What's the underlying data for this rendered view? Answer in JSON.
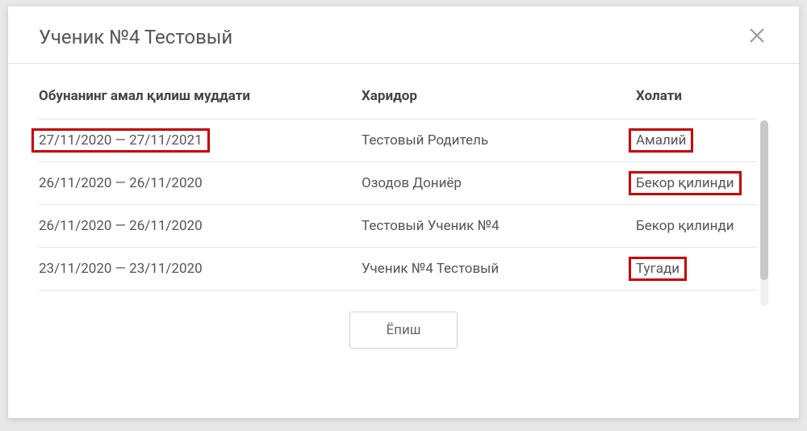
{
  "modal": {
    "title": "Ученик №4 Тестовый",
    "closeButtonLabel": "Ёпиш"
  },
  "table": {
    "headers": {
      "period": "Обунанинг амал қилиш муддати",
      "buyer": "Харидор",
      "status": "Холати"
    },
    "rows": [
      {
        "period": "27/11/2020 — 27/11/2021",
        "buyer": "Тестовый Родитель",
        "status": "Амалий",
        "highlightPeriod": true,
        "highlightStatus": true
      },
      {
        "period": "26/11/2020 — 26/11/2020",
        "buyer": "Озодов Дониёр",
        "status": "Бекор қилинди",
        "highlightPeriod": false,
        "highlightStatus": true
      },
      {
        "period": "26/11/2020 — 26/11/2020",
        "buyer": "Тестовый Ученик №4",
        "status": "Бекор қилинди",
        "highlightPeriod": false,
        "highlightStatus": false
      },
      {
        "period": "23/11/2020 — 23/11/2020",
        "buyer": "Ученик №4 Тестовый",
        "status": "Тугади",
        "highlightPeriod": false,
        "highlightStatus": true
      }
    ]
  }
}
